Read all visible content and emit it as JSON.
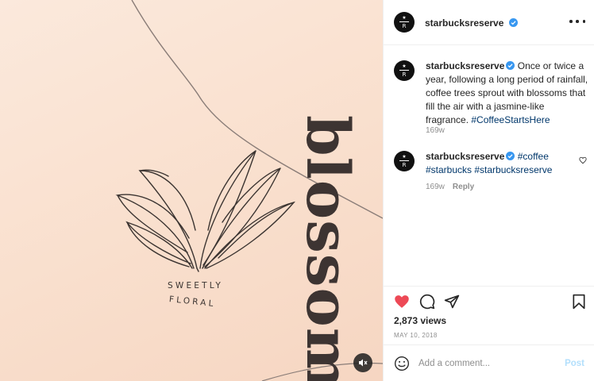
{
  "media": {
    "line1": "SWEETLY",
    "line2": "FLORAL",
    "big_word": "blossom",
    "mute_icon": "speaker-muted-icon"
  },
  "account": {
    "username": "starbucksreserve",
    "avatar_star": "★",
    "avatar_letter": "R",
    "verified_color": "#3897f0"
  },
  "caption": {
    "username": "starbucksreserve",
    "text": "Once or twice a year, following a long period of rainfall, coffee trees sprout with blossoms that fill the air with a jasmine-like fragrance.",
    "hashtag": "#CoffeeStartsHere",
    "age": "169w"
  },
  "comment": {
    "username": "starbucksreserve",
    "tags": [
      "#coffee",
      "#starbucks",
      "#starbucksreserve"
    ],
    "age": "169w",
    "reply_label": "Reply"
  },
  "actions": {
    "liked_color": "#ed4956",
    "views": "2,873 views",
    "date": "MAY 10, 2018"
  },
  "add_comment": {
    "placeholder": "Add a comment...",
    "post_label": "Post"
  }
}
